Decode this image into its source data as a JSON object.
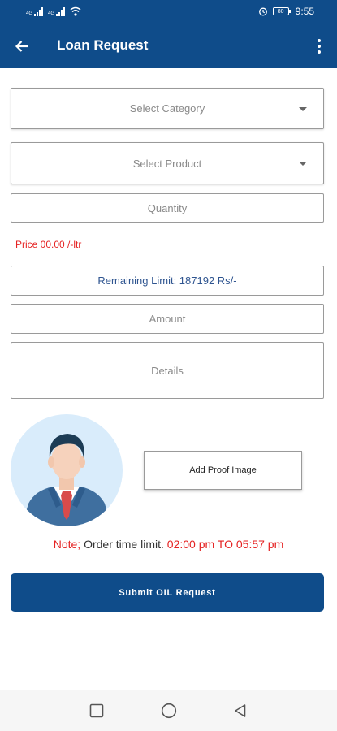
{
  "status_bar": {
    "left_network_labels": [
      "4G",
      "4G"
    ],
    "time": "9:55",
    "battery": "80"
  },
  "app_bar": {
    "title": "Loan Request"
  },
  "form": {
    "category_placeholder": "Select Category",
    "product_placeholder": "Select Product",
    "quantity_placeholder": "Quantity",
    "price_text": "Price 00.00 /-ltr",
    "remaining_limit_text": "Remaining Limit: 187192 Rs/-",
    "amount_placeholder": "Amount",
    "details_placeholder": "Details"
  },
  "proof": {
    "button_label": "Add Proof Image"
  },
  "note": {
    "prefix": "Note;",
    "middle": "Order time limit.",
    "time_range": "02:00 pm TO 05:57 pm"
  },
  "submit_button": {
    "label": "Submit OIL Request"
  },
  "colors": {
    "primary": "#0f4c8a",
    "accent_red": "#e52222",
    "limit_text": "#2f5590"
  },
  "icons": {
    "back": "arrow-left-icon",
    "menu": "more-vertical-icon",
    "dropdown": "caret-down-icon",
    "nav_recent": "square-icon",
    "nav_home": "circle-icon",
    "nav_back": "triangle-icon"
  }
}
